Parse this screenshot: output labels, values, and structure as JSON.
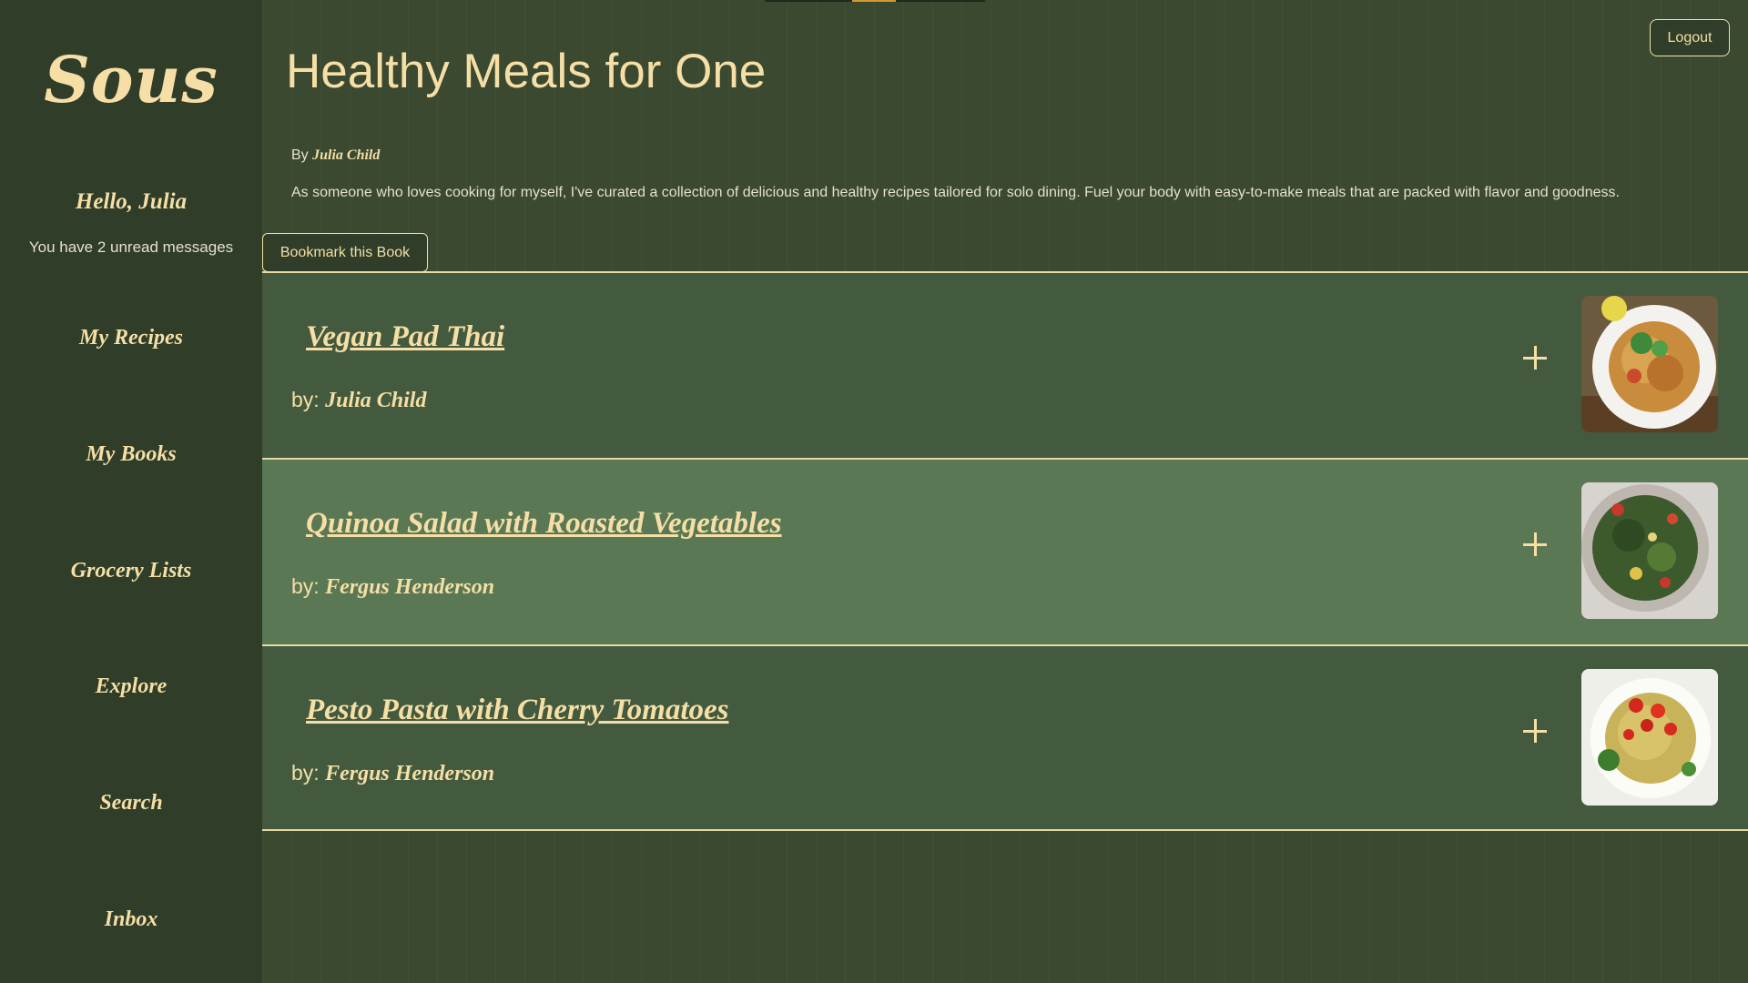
{
  "app": {
    "logo": "Sous"
  },
  "sidebar": {
    "greeting": "Hello, Julia",
    "unread": "You have 2 unread messages",
    "nav": [
      "My Recipes",
      "My Books",
      "Grocery Lists",
      "Explore",
      "Search",
      "Inbox"
    ]
  },
  "header": {
    "logout_label": "Logout"
  },
  "book": {
    "title": "Healthy Meals for One",
    "by_prefix": "By",
    "author": "Julia Child",
    "description": "As someone who loves cooking for myself, I've curated a collection of delicious and healthy recipes tailored for solo dining. Fuel your body with easy-to-make meals that are packed with flavor and goodness.",
    "bookmark_label": "Bookmark this Book"
  },
  "recipes": [
    {
      "title": "Vegan Pad Thai",
      "by_prefix": "by:",
      "author": "Julia Child",
      "image": "pad-thai-photo"
    },
    {
      "title": "Quinoa Salad with Roasted Vegetables",
      "by_prefix": "by:",
      "author": "Fergus Henderson",
      "image": "quinoa-salad-photo"
    },
    {
      "title": "Pesto Pasta with Cherry Tomatoes",
      "by_prefix": "by:",
      "author": "Fergus Henderson",
      "image": "pesto-pasta-photo"
    }
  ],
  "colors": {
    "cream": "#f5dfa6",
    "sidebar": "#2f3d29",
    "main": "#3a4930",
    "row": "#445a3e",
    "row_alt": "#5b7854"
  }
}
